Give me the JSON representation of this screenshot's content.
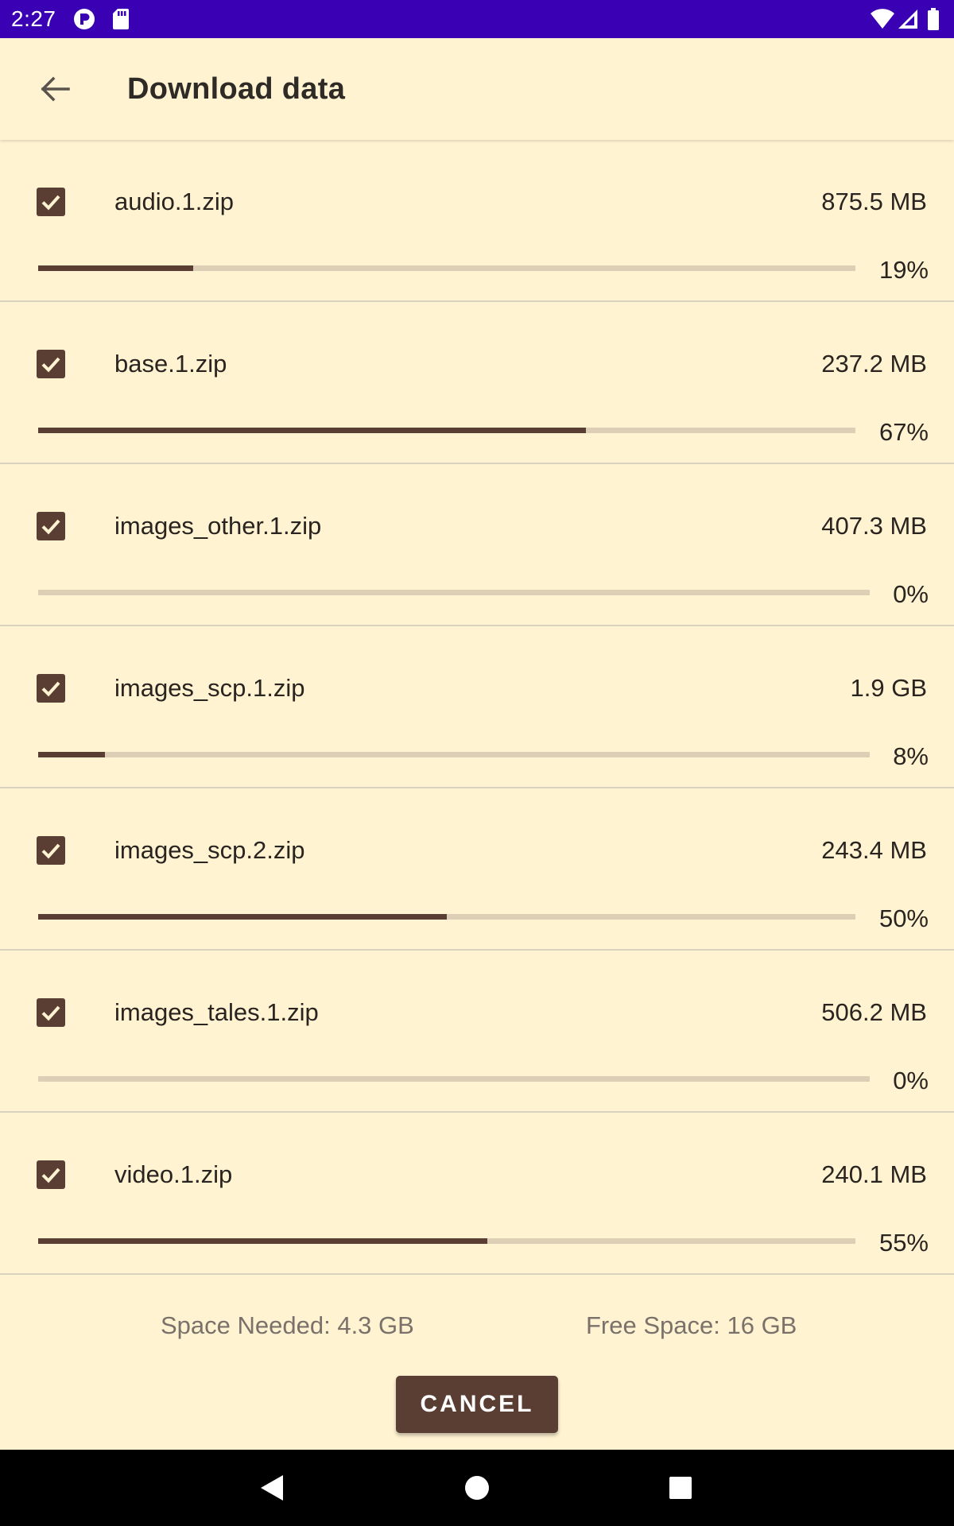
{
  "status_bar": {
    "time": "2:27",
    "left_icons": [
      "app-notification-icon",
      "sd-card-icon"
    ],
    "right_icons": [
      "wifi-icon",
      "cell-signal-icon",
      "battery-icon"
    ],
    "background": "#3a00b4"
  },
  "header": {
    "title": "Download data",
    "back_icon": "arrow-back-icon"
  },
  "files": [
    {
      "name": "audio.1.zip",
      "size": "875.5 MB",
      "checked": true,
      "progress_percent": 19,
      "progress_label": "19%"
    },
    {
      "name": "base.1.zip",
      "size": "237.2 MB",
      "checked": true,
      "progress_percent": 67,
      "progress_label": "67%"
    },
    {
      "name": "images_other.1.zip",
      "size": "407.3 MB",
      "checked": true,
      "progress_percent": 0,
      "progress_label": "0%"
    },
    {
      "name": "images_scp.1.zip",
      "size": "1.9 GB",
      "checked": true,
      "progress_percent": 8,
      "progress_label": "8%"
    },
    {
      "name": "images_scp.2.zip",
      "size": "243.4 MB",
      "checked": true,
      "progress_percent": 50,
      "progress_label": "50%"
    },
    {
      "name": "images_tales.1.zip",
      "size": "506.2 MB",
      "checked": true,
      "progress_percent": 0,
      "progress_label": "0%"
    },
    {
      "name": "video.1.zip",
      "size": "240.1 MB",
      "checked": true,
      "progress_percent": 55,
      "progress_label": "55%"
    }
  ],
  "footer": {
    "space_needed": "Space Needed: 4.3 GB",
    "free_space": "Free Space: 16 GB",
    "cancel_label": "CANCEL"
  },
  "nav_bar": {
    "icons": [
      "back-triangle-icon",
      "home-circle-icon",
      "recents-square-icon"
    ]
  },
  "colors": {
    "background": "#fff3d2",
    "accent": "#5a3e33",
    "track": "#dccfb6",
    "secondary_text": "#7a726a"
  }
}
